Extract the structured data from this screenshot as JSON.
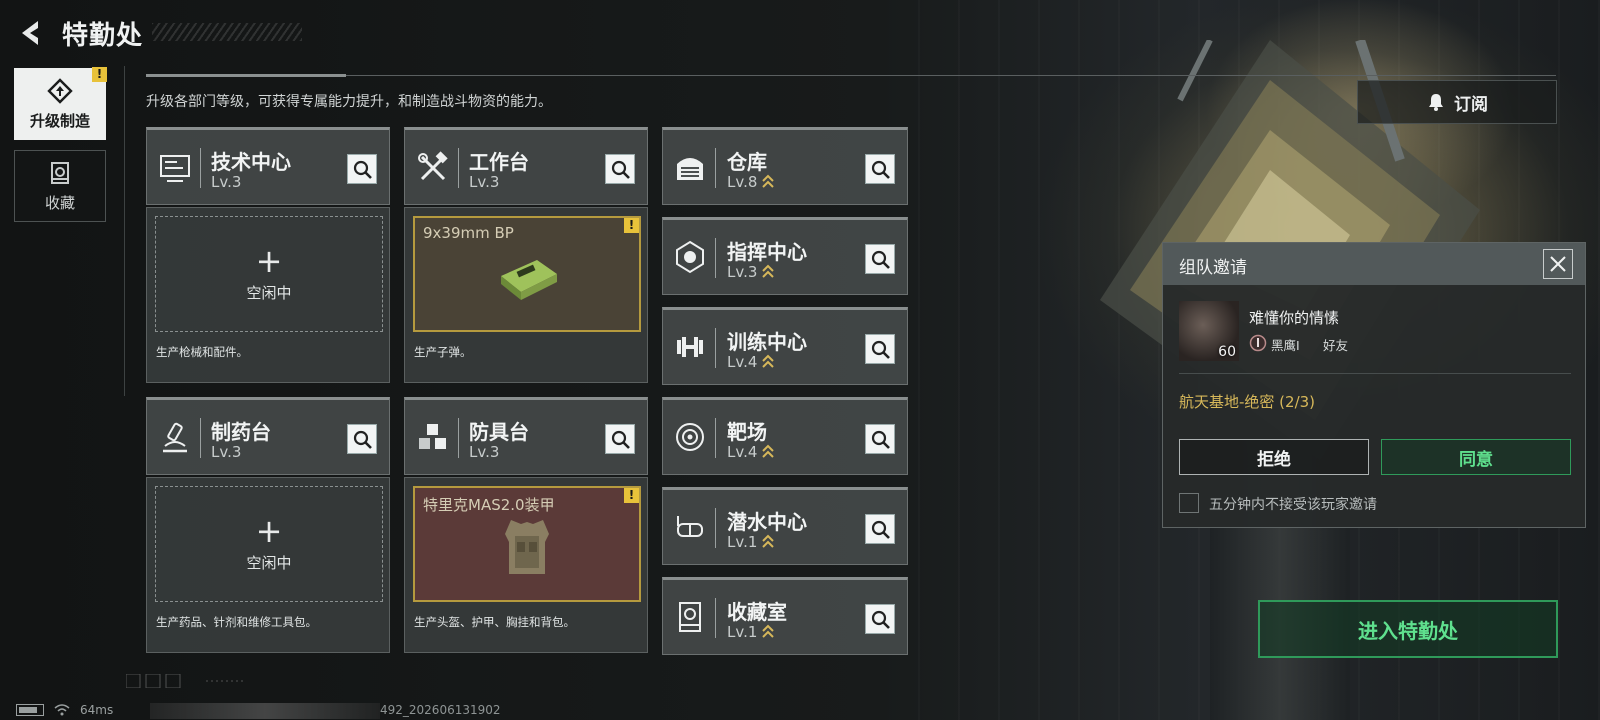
{
  "header": {
    "title": "特勤处"
  },
  "tabs": [
    {
      "label": "升级制造",
      "active": true,
      "icon": "upgrade-craft-icon",
      "warning": "!"
    },
    {
      "label": "收藏",
      "active": false,
      "icon": "collection-icon"
    }
  ],
  "description": "升级各部门等级，可获得专属能力提升，和制造战斗物资的能力。",
  "subscribe": {
    "label": "订阅",
    "icon": "bell-icon"
  },
  "production_cards": [
    {
      "name": "技术中心",
      "level": "Lv.3",
      "icon": "tech-center-icon",
      "slot_state": "空闲中",
      "slot_item": "",
      "desc": "生产枪械和配件。"
    },
    {
      "name": "工作台",
      "level": "Lv.3",
      "icon": "workbench-icon",
      "slot_state": "",
      "slot_item": "9x39mm BP",
      "warning": "!",
      "desc": "生产子弹。"
    },
    {
      "name": "制药台",
      "level": "Lv.3",
      "icon": "pharmacy-icon",
      "slot_state": "空闲中",
      "slot_item": "",
      "desc": "生产药品、针剂和维修工具包。"
    },
    {
      "name": "防具台",
      "level": "Lv.3",
      "icon": "armor-bench-icon",
      "slot_state": "",
      "slot_item": "特里克MAS2.0装甲",
      "warning": "!",
      "desc": "生产头盔、护甲、胸挂和背包。"
    }
  ],
  "facilities": [
    {
      "name": "仓库",
      "level": "Lv.8",
      "icon": "warehouse-icon",
      "upgrade": true
    },
    {
      "name": "指挥中心",
      "level": "Lv.3",
      "icon": "command-center-icon",
      "upgrade": true
    },
    {
      "name": "训练中心",
      "level": "Lv.4",
      "icon": "training-center-icon",
      "upgrade": true
    },
    {
      "name": "靶场",
      "level": "Lv.4",
      "icon": "shooting-range-icon",
      "upgrade": true
    },
    {
      "name": "潜水中心",
      "level": "Lv.1",
      "icon": "diving-center-icon",
      "upgrade": true
    },
    {
      "name": "收藏室",
      "level": "Lv.1",
      "icon": "collection-room-icon",
      "upgrade": true
    }
  ],
  "invite_dialog": {
    "title": "组队邀请",
    "player": {
      "name": "难懂你的情愫",
      "level": "60",
      "rank": "黑鹰I",
      "relation": "好友"
    },
    "mission": "航天基地-绝密 (2/3)",
    "refuse_label": "拒绝",
    "accept_label": "同意",
    "mute_checkbox_label": "五分钟内不接受该玩家邀请",
    "mute_checked": false
  },
  "enter_button": {
    "label": "进入特勤处"
  },
  "status_bar": {
    "ping": "64ms",
    "uid_suffix": "492_202606131902"
  },
  "colors": {
    "accent_green": "#5fe08e",
    "warning_yellow": "#e8c23a",
    "gold_text": "#d7b85a"
  }
}
